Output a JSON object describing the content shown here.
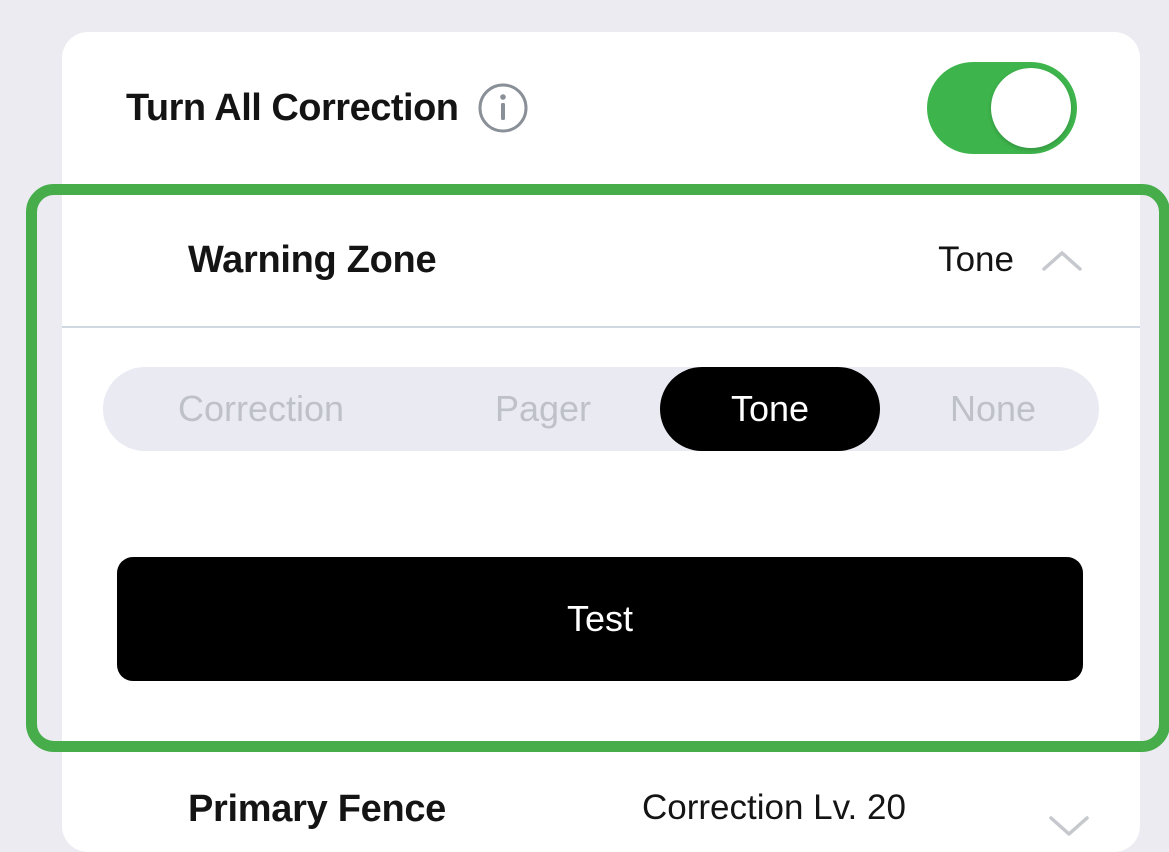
{
  "master": {
    "label": "Turn All Correction",
    "info_icon": "info-circle-icon",
    "toggle_on": true,
    "toggle_color": "#3eb44c"
  },
  "warning_zone": {
    "title": "Warning Zone",
    "value": "Tone",
    "expanded": true,
    "chevron_icon": "chevron-up-icon",
    "options": [
      "Correction",
      "Pager",
      "Tone",
      "None"
    ],
    "selected": "Tone",
    "test_label": "Test",
    "highlight_color": "#46ad4a"
  },
  "primary_fence": {
    "title": "Primary Fence",
    "value": "Correction Lv. 20",
    "chevron_icon": "chevron-down-icon"
  }
}
